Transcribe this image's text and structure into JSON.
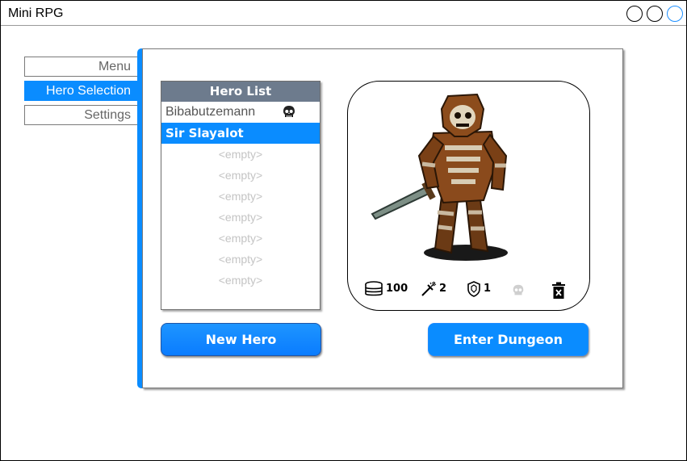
{
  "window": {
    "title": "Mini RPG"
  },
  "nav": {
    "items": [
      {
        "label": "Menu",
        "active": false
      },
      {
        "label": "Hero Selection",
        "active": true
      },
      {
        "label": "Settings",
        "active": false
      }
    ]
  },
  "hero_list": {
    "title": "Hero List",
    "rows": [
      {
        "label": "Bibabutzemann",
        "state": "filled",
        "icon": "skull-icon"
      },
      {
        "label": "Sir Slayalot",
        "state": "selected"
      },
      {
        "label": "<empty>",
        "state": "empty"
      },
      {
        "label": "<empty>",
        "state": "empty"
      },
      {
        "label": "<empty>",
        "state": "empty"
      },
      {
        "label": "<empty>",
        "state": "empty"
      },
      {
        "label": "<empty>",
        "state": "empty"
      },
      {
        "label": "<empty>",
        "state": "empty"
      },
      {
        "label": "<empty>",
        "state": "empty"
      }
    ]
  },
  "hero_detail": {
    "gold": "100",
    "weapon_level": "2",
    "armor_level": "1",
    "icons": [
      "coins-icon",
      "sword-icon",
      "shield-icon",
      "skull-icon",
      "trash-icon"
    ]
  },
  "buttons": {
    "new_hero": "New Hero",
    "enter_dungeon": "Enter Dungeon"
  },
  "colors": {
    "accent": "#0a8cff",
    "list_header": "#6d7b8d",
    "empty_text": "#c4c4c4"
  }
}
